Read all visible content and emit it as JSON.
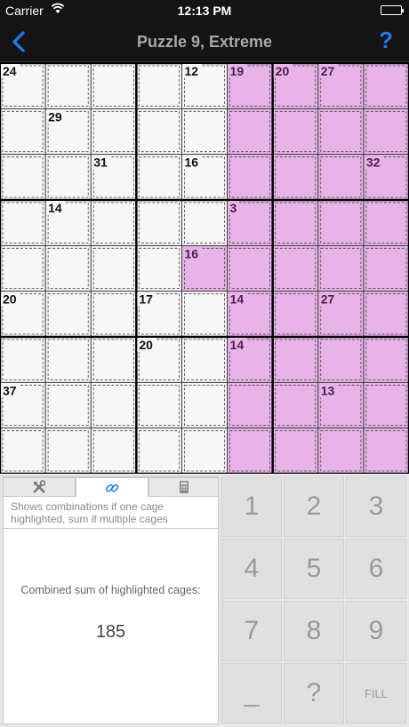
{
  "status_bar": {
    "carrier": "Carrier",
    "time": "12:13 PM"
  },
  "nav": {
    "title": "Puzzle 9, Extreme",
    "help": "?"
  },
  "colors": {
    "highlight": "#e8b4e8",
    "highlight_border": "#9a4f9a",
    "accent": "#1e7cf2",
    "cell_bg": "#f7f7f7"
  },
  "grid": {
    "size": 9,
    "highlighted_cells": [
      [
        0,
        5
      ],
      [
        0,
        6
      ],
      [
        0,
        7
      ],
      [
        0,
        8
      ],
      [
        1,
        5
      ],
      [
        1,
        6
      ],
      [
        1,
        7
      ],
      [
        1,
        8
      ],
      [
        2,
        5
      ],
      [
        2,
        6
      ],
      [
        2,
        7
      ],
      [
        2,
        8
      ],
      [
        3,
        5
      ],
      [
        3,
        6
      ],
      [
        3,
        7
      ],
      [
        3,
        8
      ],
      [
        4,
        4
      ],
      [
        4,
        5
      ],
      [
        4,
        6
      ],
      [
        4,
        7
      ],
      [
        4,
        8
      ],
      [
        5,
        5
      ],
      [
        5,
        6
      ],
      [
        5,
        7
      ],
      [
        5,
        8
      ],
      [
        6,
        5
      ],
      [
        6,
        6
      ],
      [
        6,
        7
      ],
      [
        6,
        8
      ],
      [
        7,
        5
      ],
      [
        7,
        6
      ],
      [
        7,
        7
      ],
      [
        7,
        8
      ],
      [
        8,
        5
      ],
      [
        8,
        6
      ],
      [
        8,
        7
      ],
      [
        8,
        8
      ]
    ],
    "cage_sums": [
      {
        "row": 0,
        "col": 0,
        "sum": "24"
      },
      {
        "row": 0,
        "col": 4,
        "sum": "12"
      },
      {
        "row": 0,
        "col": 5,
        "sum": "19"
      },
      {
        "row": 0,
        "col": 6,
        "sum": "20"
      },
      {
        "row": 0,
        "col": 7,
        "sum": "27"
      },
      {
        "row": 1,
        "col": 1,
        "sum": "29"
      },
      {
        "row": 2,
        "col": 2,
        "sum": "31"
      },
      {
        "row": 2,
        "col": 4,
        "sum": "16"
      },
      {
        "row": 2,
        "col": 8,
        "sum": "32"
      },
      {
        "row": 3,
        "col": 1,
        "sum": "14"
      },
      {
        "row": 3,
        "col": 5,
        "sum": "3"
      },
      {
        "row": 4,
        "col": 4,
        "sum": "16"
      },
      {
        "row": 5,
        "col": 0,
        "sum": "20"
      },
      {
        "row": 5,
        "col": 3,
        "sum": "17"
      },
      {
        "row": 5,
        "col": 5,
        "sum": "14"
      },
      {
        "row": 5,
        "col": 7,
        "sum": "27"
      },
      {
        "row": 6,
        "col": 3,
        "sum": "20"
      },
      {
        "row": 6,
        "col": 5,
        "sum": "14"
      },
      {
        "row": 7,
        "col": 0,
        "sum": "37"
      },
      {
        "row": 7,
        "col": 7,
        "sum": "13"
      }
    ]
  },
  "panel": {
    "tabs": [
      {
        "icon": "tools-icon",
        "active": false
      },
      {
        "icon": "link-icon",
        "active": true
      },
      {
        "icon": "calculator-icon",
        "active": false
      }
    ],
    "hint": "Shows combinations if one cage highlighted, sum if multiple cages",
    "sum_label": "Combined sum of highlighted cages:",
    "sum_value": "185"
  },
  "keypad": {
    "keys": [
      "1",
      "2",
      "3",
      "4",
      "5",
      "6",
      "7",
      "8",
      "9",
      "_",
      "?",
      "FILL"
    ]
  }
}
